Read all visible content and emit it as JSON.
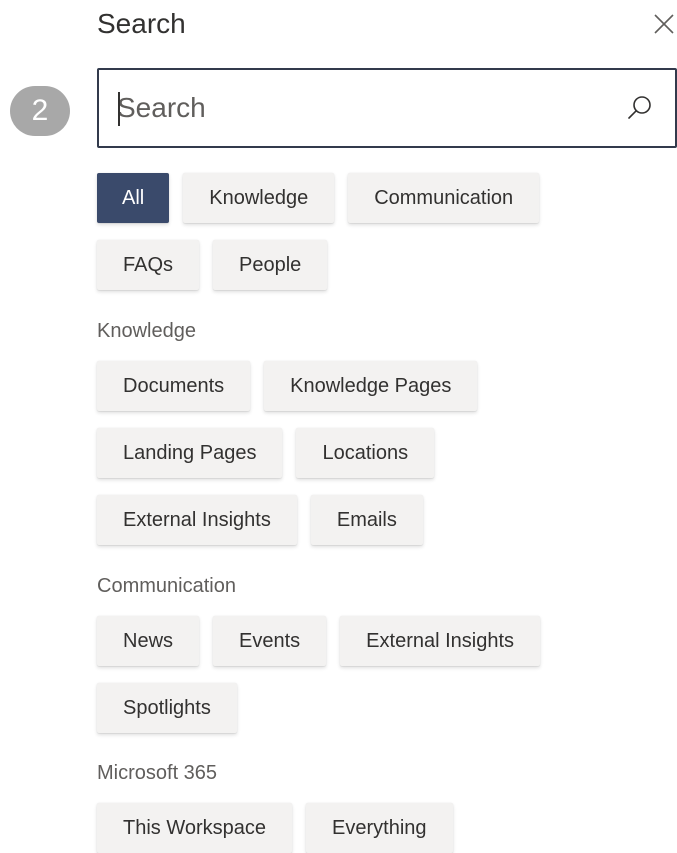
{
  "panel": {
    "title": "Search",
    "step_badge": "2"
  },
  "search": {
    "placeholder": "Search",
    "value": ""
  },
  "icons": {
    "close": "close-icon",
    "search": "search-icon"
  },
  "colors": {
    "selected_chip_bg": "#3a4a6b",
    "chip_bg": "#f3f2f1",
    "search_border": "#323a4c",
    "badge_bg": "#a8a8a8"
  },
  "filters": {
    "top": [
      "All",
      "Knowledge",
      "Communication",
      "FAQs",
      "People"
    ],
    "selected": "All"
  },
  "sections": [
    {
      "label": "Knowledge",
      "items": [
        "Documents",
        "Knowledge Pages",
        "Landing Pages",
        "Locations",
        "External Insights",
        "Emails"
      ]
    },
    {
      "label": "Communication",
      "items": [
        "News",
        "Events",
        "External Insights",
        "Spotlights"
      ]
    },
    {
      "label": "Microsoft 365",
      "items": [
        "This Workspace",
        "Everything"
      ]
    }
  ]
}
